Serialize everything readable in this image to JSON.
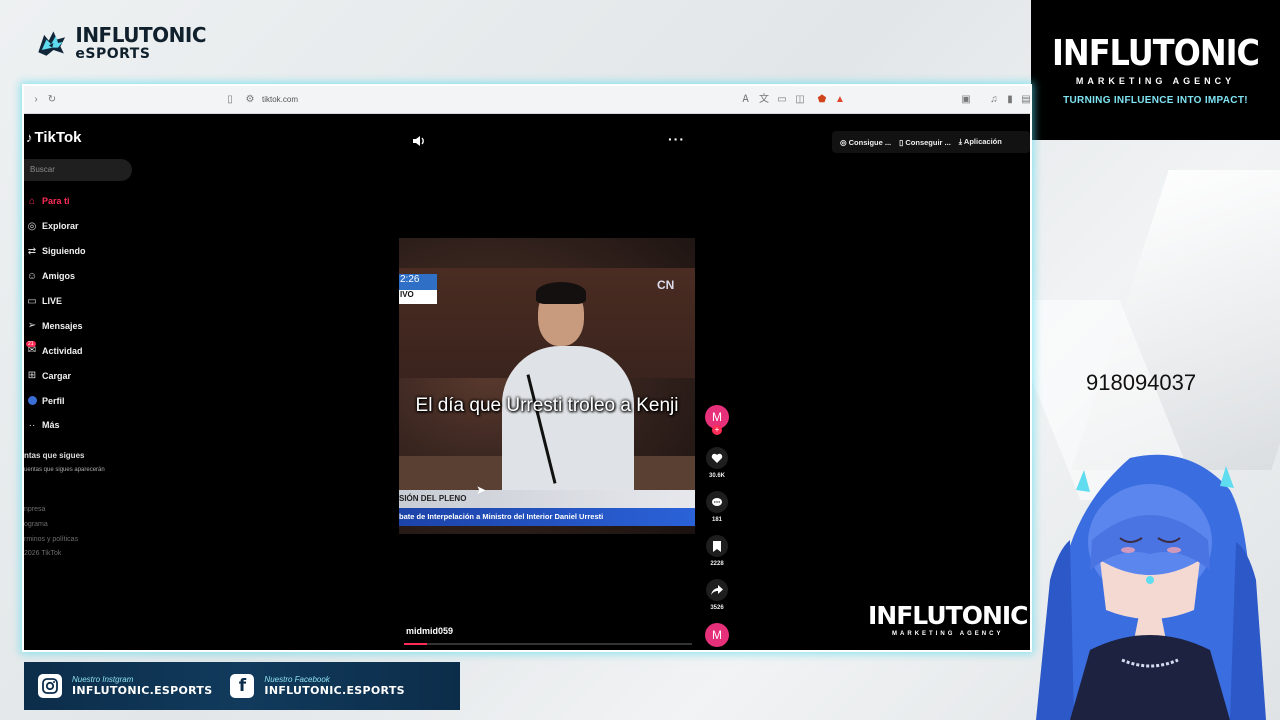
{
  "overlay": {
    "top_left_logo": {
      "name": "INFLUTONIC",
      "sub": "eSPORTS"
    },
    "brand": {
      "name": "INFLUTONIC",
      "agency": "MARKETING AGENCY",
      "tagline": "TURNING INFLUENCE INTO IMPACT!"
    },
    "phone": "918094037",
    "watermark": {
      "name": "INFLUTONIC",
      "agency": "MARKETING AGENCY"
    },
    "social": [
      {
        "label": "Nuestro Instgram",
        "handle": "INFLUTONIC.ESPORTS",
        "icon": "instagram-icon"
      },
      {
        "label": "Nuestro Facebook",
        "handle": "INFLUTONIC.ESPORTS",
        "icon": "facebook-icon"
      }
    ],
    "colors": {
      "accent": "#5fdcef",
      "tiktok_red": "#fe2c55",
      "banner": "#0c2d4a"
    }
  },
  "browser": {
    "url": "tiktok.com"
  },
  "tiktok": {
    "logo": "TikTok",
    "search_placeholder": "Buscar",
    "nav": [
      {
        "label": "Para ti",
        "icon": "home-icon",
        "active": true
      },
      {
        "label": "Explorar",
        "icon": "compass-icon"
      },
      {
        "label": "Siguiendo",
        "icon": "following-icon"
      },
      {
        "label": "Amigos",
        "icon": "friends-icon"
      },
      {
        "label": "LIVE",
        "icon": "live-icon"
      },
      {
        "label": "Mensajes",
        "icon": "messages-icon"
      },
      {
        "label": "Actividad",
        "icon": "activity-icon",
        "badge": "21"
      },
      {
        "label": "Cargar",
        "icon": "upload-icon"
      },
      {
        "label": "Perfil",
        "icon": "profile-icon"
      },
      {
        "label": "Más",
        "icon": "more-icon"
      }
    ],
    "following_heading": "ntas que sigues",
    "following_sub": "uentas que sigues aparecerán",
    "footer": [
      "npresa",
      "ograma",
      "rminos y políticas",
      "2026 TikTok"
    ],
    "top_actions": [
      "Consigue ...",
      "Conseguir ...",
      "Aplicación"
    ],
    "video": {
      "caption": "El día que Urresti troleo a Kenji",
      "timestamp": "2:26",
      "live_tag": "IVO",
      "channel": "CN",
      "lower_third_1": "SIÓN DEL PLENO",
      "lower_third_2": "bate de Interpelación a Ministro del Interior Daniel Urresti",
      "username": "midmid059",
      "progress": 0.08
    },
    "creator_avatar": "M",
    "actions": [
      {
        "name": "like",
        "count": "30.6K",
        "icon": "heart-icon"
      },
      {
        "name": "comment",
        "count": "181",
        "icon": "comment-icon"
      },
      {
        "name": "save",
        "count": "2228",
        "icon": "bookmark-icon"
      },
      {
        "name": "share",
        "count": "3526",
        "icon": "share-icon"
      }
    ]
  }
}
